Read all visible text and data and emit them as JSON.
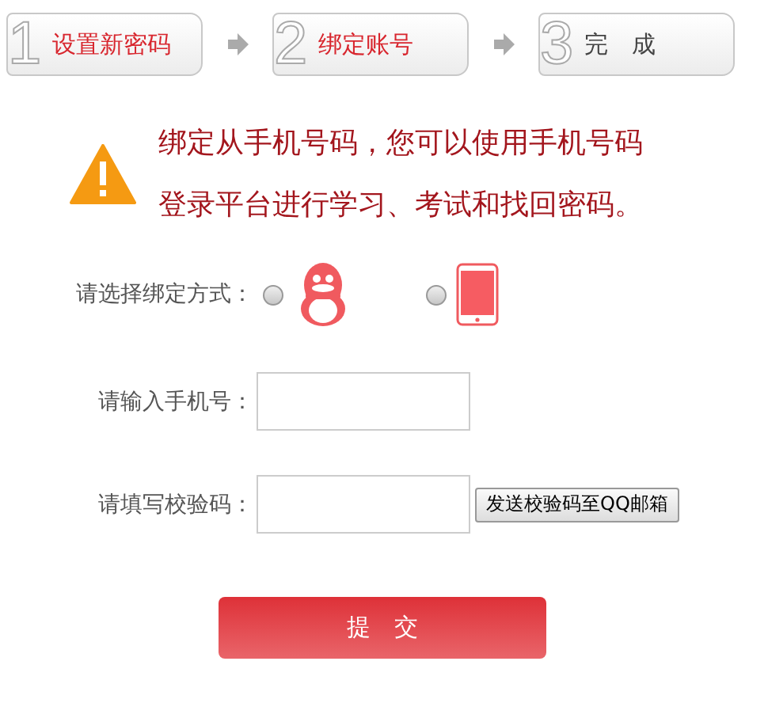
{
  "steps": [
    {
      "number": "1",
      "label": "设置新密码",
      "active": true
    },
    {
      "number": "2",
      "label": "绑定账号",
      "active": true
    },
    {
      "number": "3",
      "label": "完　成",
      "active": false
    }
  ],
  "notice": {
    "lines": [
      "绑定从手机号码，您可以使用手机号码",
      "登录平台进行学习、考试和找回密码。"
    ]
  },
  "form": {
    "method_label": "请选择绑定方式：",
    "methods": [
      {
        "kind": "qq",
        "selected": false
      },
      {
        "kind": "phone",
        "selected": false
      }
    ],
    "phone_label": "请输入手机号：",
    "code_label": "请填写校验码：",
    "send_button": "发送校验码至QQ邮箱"
  },
  "submit": "提　交"
}
